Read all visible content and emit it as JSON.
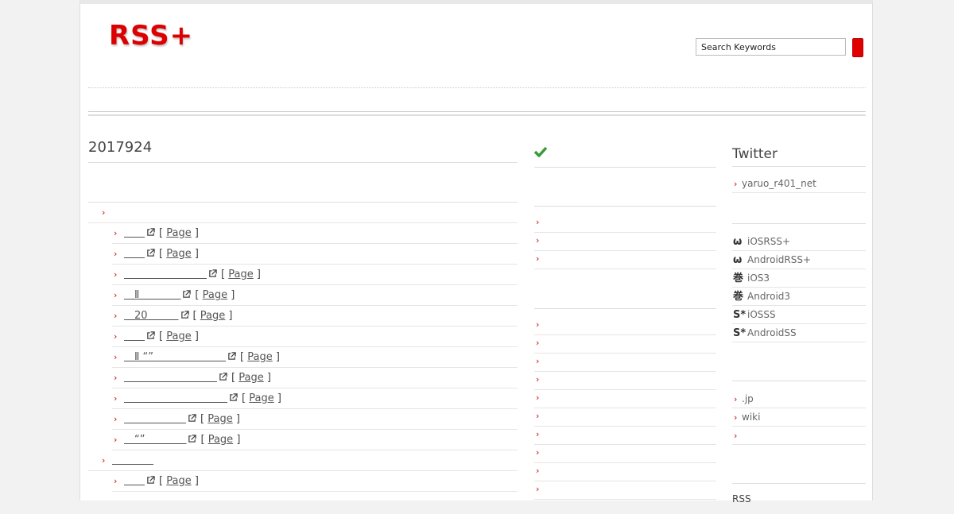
{
  "header": {
    "logo": "RSS+",
    "search_placeholder": "Search Keywords"
  },
  "main": {
    "date": "2017924",
    "page_label": "Page",
    "rows": [
      {
        "type": "cat",
        "link": ""
      },
      {
        "type": "item",
        "link": "＿＿"
      },
      {
        "type": "item",
        "link": "＿＿"
      },
      {
        "type": "item",
        "link": "＿＿＿＿＿＿＿＿"
      },
      {
        "type": "item",
        "link": "＿Ⅱ＿＿＿＿"
      },
      {
        "type": "item",
        "link": "＿20＿＿＿"
      },
      {
        "type": "item",
        "link": "＿＿"
      },
      {
        "type": "item",
        "link": "＿Ⅱ “”＿＿＿＿＿＿＿"
      },
      {
        "type": "item",
        "link": "＿＿＿＿＿＿＿＿＿"
      },
      {
        "type": "item",
        "link": "＿＿＿＿＿＿＿＿＿＿"
      },
      {
        "type": "item",
        "link": "＿＿＿＿＿＿"
      },
      {
        "type": "item",
        "link": "＿“”＿＿＿＿"
      },
      {
        "type": "cat",
        "link": "＿＿＿＿"
      },
      {
        "type": "item",
        "link": "＿＿"
      }
    ]
  },
  "side": {
    "twitter_title": "Twitter",
    "twitter_account": "yaruo_r401_net",
    "apps": [
      {
        "icon": "ω",
        "label": "iOSRSS+"
      },
      {
        "icon": "ω",
        "label": "AndroidRSS+"
      },
      {
        "icon": "巻",
        "label": "iOS3"
      },
      {
        "icon": "巻",
        "label": "Android3"
      },
      {
        "icon": "S*",
        "label": "iOSSS"
      },
      {
        "icon": "S*",
        "label": "AndroidSS"
      }
    ],
    "links": [
      ".jp",
      "wiki",
      ""
    ],
    "rss": "RSS"
  },
  "colors": {
    "accent": "#dd0000",
    "check": "#3a9a3a"
  }
}
